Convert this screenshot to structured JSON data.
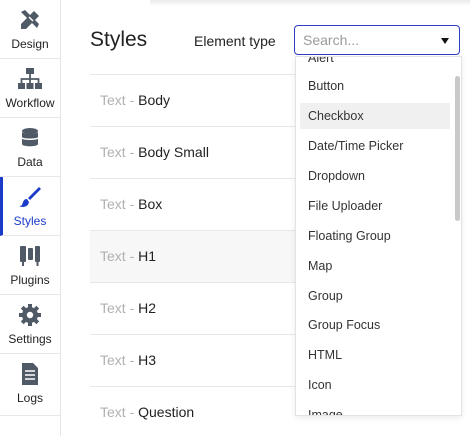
{
  "sidebar": {
    "items": [
      {
        "label": "Design",
        "icon": "design-tools-icon"
      },
      {
        "label": "Workflow",
        "icon": "workflow-icon"
      },
      {
        "label": "Data",
        "icon": "database-icon"
      },
      {
        "label": "Styles",
        "icon": "paintbrush-icon",
        "active": true
      },
      {
        "label": "Plugins",
        "icon": "plugins-icon"
      },
      {
        "label": "Settings",
        "icon": "gear-icon"
      },
      {
        "label": "Logs",
        "icon": "document-icon"
      }
    ]
  },
  "main": {
    "title": "Styles",
    "element_type_label": "Element type",
    "search_placeholder": "Search..."
  },
  "styles": [
    {
      "prefix": "Text - ",
      "name": "Body"
    },
    {
      "prefix": "Text - ",
      "name": "Body Small"
    },
    {
      "prefix": "Text - ",
      "name": "Box"
    },
    {
      "prefix": "Text - ",
      "name": "H1"
    },
    {
      "prefix": "Text - ",
      "name": "H2"
    },
    {
      "prefix": "Text - ",
      "name": "H3"
    },
    {
      "prefix": "Text - ",
      "name": "Question"
    }
  ],
  "dropdown": {
    "options": [
      "Alert",
      "Button",
      "Checkbox",
      "Date/Time Picker",
      "Dropdown",
      "File Uploader",
      "Floating Group",
      "Map",
      "Group",
      "Group Focus",
      "HTML",
      "Icon",
      "Image"
    ],
    "highlighted": "Checkbox"
  },
  "colors": {
    "accent": "#1a3cc8",
    "icon": "#505a66"
  }
}
